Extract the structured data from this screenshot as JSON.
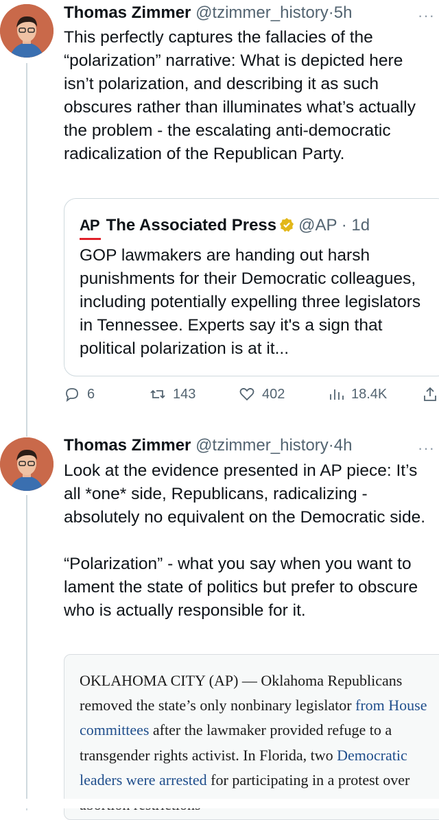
{
  "tweets": [
    {
      "author": "Thomas Zimmer",
      "handle": "@tzimmer_history",
      "time": "5h",
      "more": "···",
      "text": "This perfectly captures the fallacies of the “polarization” narrative: What is depicted here isn’t polarization, and describing it as such obscures rather than illuminates what’s actually the problem - the escalating anti-democratic radicalization of the Republican Party.",
      "quote": {
        "logo": "AP",
        "author": "The Associated Press",
        "handle": "@AP",
        "time": "1d",
        "text": "GOP lawmakers are handing out harsh punishments for their Democratic colleagues, including potentially expelling three legislators in Tennessee. Experts say it's a sign that political polarization is at it..."
      },
      "actions": {
        "replies": "6",
        "retweets": "143",
        "likes": "402",
        "views": "18.4K"
      }
    },
    {
      "author": "Thomas Zimmer",
      "handle": "@tzimmer_history",
      "time": "4h",
      "more": "···",
      "text": "Look at the evidence presented in AP piece: It’s all *one* side, Republicans, radicalizing - absolutely no equivalent on the Democratic side.\n\n“Polarization” - what you say when you want to lament the state of politics but prefer to obscure who is actually responsible for it.",
      "article": {
        "t1": "OKLAHOMA CITY (AP) — Oklahoma Republicans removed the state’s only nonbinary legislator ",
        "link1": "from House committees",
        "t2": " after the lawmaker provided refuge to a transgender rights activist. In Florida, two ",
        "link2": "Democratic leaders were arrested",
        "t3": " for participating in a protest over abortion restrictions"
      }
    }
  ],
  "colors": {
    "accent_link": "#1f4e8c",
    "ap_red": "#e0202a",
    "verified_gold": "#e2b719"
  }
}
